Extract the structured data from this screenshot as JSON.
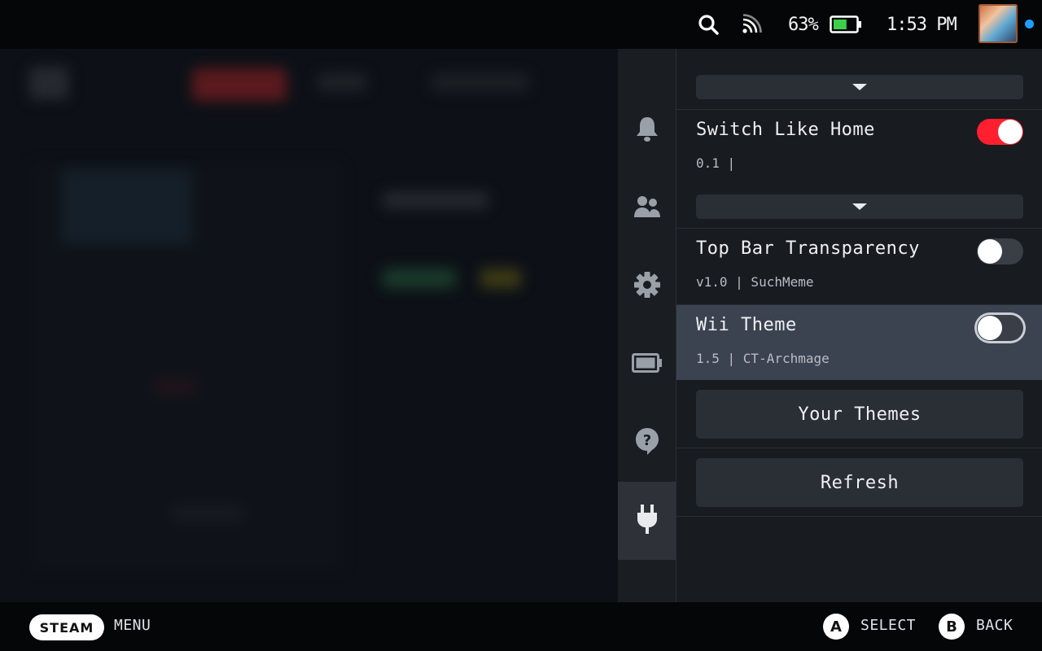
{
  "topbar": {
    "icons": [
      "search-icon",
      "wifi-icon",
      "battery-icon"
    ],
    "battery_percent": "63%",
    "battery_level": 0.63,
    "clock": "1:53 PM",
    "notification_color": "#1a9fff"
  },
  "rail": {
    "tabs": [
      {
        "icon": "bell-icon"
      },
      {
        "icon": "friends-icon"
      },
      {
        "icon": "gear-icon"
      },
      {
        "icon": "battery-icon"
      },
      {
        "icon": "help-icon"
      },
      {
        "icon": "plug-icon",
        "active": true
      }
    ]
  },
  "themes": [
    {
      "name": "Switch Like Home",
      "subtitle": "0.1 |",
      "enabled": true
    },
    {
      "name": "Top Bar Transparency",
      "subtitle": "v1.0 | SuchMeme",
      "enabled": false
    },
    {
      "name": "Wii Theme",
      "subtitle": "1.5 | CT-Archmage",
      "enabled": false,
      "focused": true
    }
  ],
  "buttons": {
    "your_themes": "Your Themes",
    "refresh": "Refresh"
  },
  "bottombar": {
    "steam_label": "STEAM",
    "menu_label": "MENU",
    "a_glyph": "A",
    "a_label": "SELECT",
    "b_glyph": "B",
    "b_label": "BACK"
  },
  "colors": {
    "toggle_on": "#ff1f2e",
    "accent": "#1a9fff"
  }
}
